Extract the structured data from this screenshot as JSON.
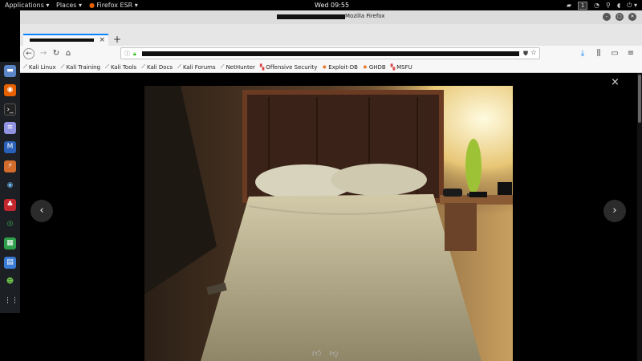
{
  "topbar": {
    "applications": "Applications ▾",
    "places": "Places ▾",
    "app": "Firefox ESR ▾",
    "clock": "Wed 09:55",
    "workspace": "1"
  },
  "window": {
    "title": "Mozilla Firefox"
  },
  "tab": {
    "close": "×"
  },
  "bookmarks": [
    {
      "label": "Kali Linux"
    },
    {
      "label": "Kali Training"
    },
    {
      "label": "Kali Tools"
    },
    {
      "label": "Kali Docs"
    },
    {
      "label": "Kali Forums"
    },
    {
      "label": "NetHunter"
    },
    {
      "label": "Offensive Security"
    },
    {
      "label": "Exploit-DB"
    },
    {
      "label": "GHDB"
    },
    {
      "label": "MSFU"
    }
  ],
  "viewer": {
    "close": "×",
    "prev": "‹",
    "next": "›"
  },
  "colors": {
    "accent": "#0a84ff",
    "lock": "#12bc00"
  }
}
